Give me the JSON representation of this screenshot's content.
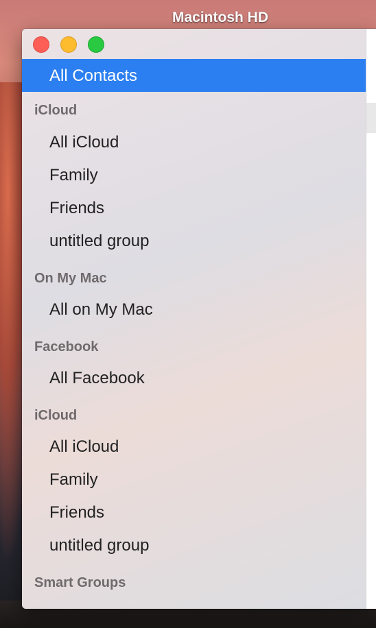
{
  "desktop": {
    "disk_label": "Macintosh HD"
  },
  "window": {
    "buttons": {
      "close": "close-button",
      "minimize": "minimize-button",
      "zoom": "zoom-button"
    }
  },
  "sidebar": {
    "selected": "All Contacts",
    "sections": [
      {
        "header": "iCloud",
        "items": [
          "All iCloud",
          "Family",
          "Friends",
          "untitled group"
        ]
      },
      {
        "header": "On My Mac",
        "items": [
          "All on My Mac"
        ]
      },
      {
        "header": "Facebook",
        "items": [
          "All Facebook"
        ]
      },
      {
        "header": "iCloud",
        "items": [
          "All iCloud",
          "Family",
          "Friends",
          "untitled group"
        ]
      },
      {
        "header": "Smart Groups",
        "items": []
      }
    ]
  },
  "colors": {
    "selection": "#2b7ff0",
    "close": "#fd5f57",
    "minimize": "#fdbc2e",
    "zoom": "#29c941"
  }
}
